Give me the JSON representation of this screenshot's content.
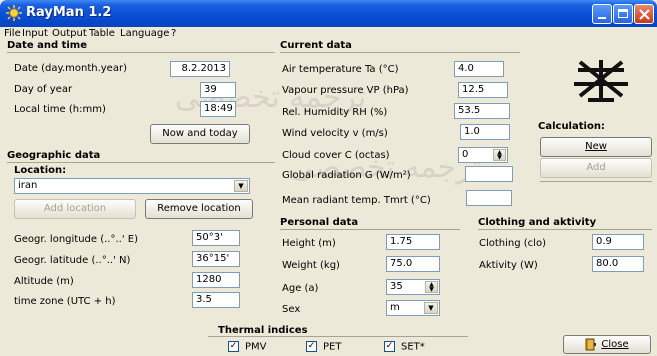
{
  "window": {
    "title": "RayMan 1.2"
  },
  "menu": {
    "items": [
      "File",
      "Input",
      "Output",
      "Table",
      "Language",
      "?"
    ]
  },
  "date_time": {
    "title": "Date and time",
    "date_label": "Date (day.month.year)",
    "date_value": "8.2.2013",
    "doy_label": "Day of year",
    "doy_value": "39",
    "time_label": "Local time (h:mm)",
    "time_value": "18:49",
    "now_button": "Now and today"
  },
  "geo": {
    "title": "Geographic data",
    "location_label": "Location:",
    "location_value": "iran",
    "add_location": "Add location",
    "remove_location": "Remove location",
    "lon_label": "Geogr. longitude (..°..' E)",
    "lon_value": "50°3'",
    "lat_label": "Geogr. latitude (..°..' N)",
    "lat_value": "36°15'",
    "alt_label": "Altitude (m)",
    "alt_value": "1280",
    "tz_label": "time zone (UTC + h)",
    "tz_value": "3.5"
  },
  "current": {
    "title": "Current data",
    "ta_label": "Air temperature Ta (°C)",
    "ta_value": "4.0",
    "vp_label": "Vapour pressure VP (hPa)",
    "vp_value": "12.5",
    "rh_label": "Rel. Humidity RH (%)",
    "rh_value": "53.5",
    "wind_label": "Wind velocity v (m/s)",
    "wind_value": "1.0",
    "cloud_label": "Cloud cover C (octas)",
    "cloud_value": "0",
    "global_label": "Global radiation G (W/m²)",
    "global_value": "",
    "tmrt_label": "Mean radiant temp. Tmrt (°C)",
    "tmrt_value": ""
  },
  "personal": {
    "title": "Personal data",
    "height_label": "Height (m)",
    "height_value": "1.75",
    "weight_label": "Weight (kg)",
    "weight_value": "75.0",
    "age_label": "Age (a)",
    "age_value": "35",
    "sex_label": "Sex",
    "sex_value": "m"
  },
  "clothing": {
    "title": "Clothing and aktivity",
    "clo_label": "Clothing (clo)",
    "clo_value": "0.9",
    "act_label": "Aktivity (W)",
    "act_value": "80.0"
  },
  "calculation": {
    "title": "Calculation:",
    "new_button": "New",
    "add_button": "Add"
  },
  "thermal": {
    "title": "Thermal indices",
    "pmv": "PMV",
    "pet": "PET",
    "set": "SET*"
  },
  "close_button": "Close",
  "colors": {
    "title_bar": "#0a4fd6",
    "window_bg": "#ece9d8",
    "field_border": "#7f9db9"
  },
  "icons": [
    "rayman-app-icon",
    "minimize-icon",
    "maximize-icon",
    "close-icon",
    "rayman-logo",
    "close-door-icon"
  ]
}
